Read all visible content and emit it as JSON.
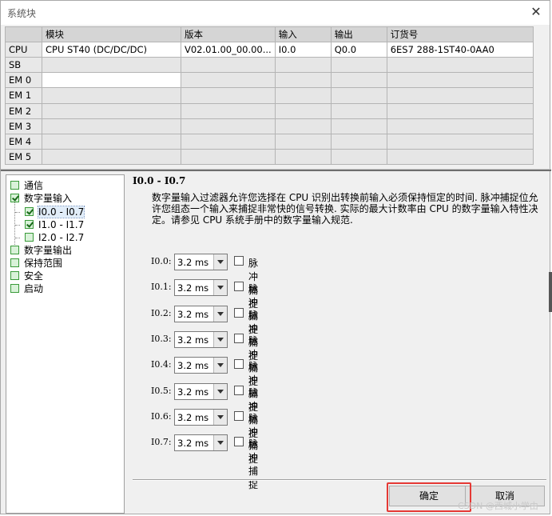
{
  "window": {
    "title": "系统块",
    "close_glyph": "✕"
  },
  "hardware_table": {
    "headers": [
      "",
      "模块",
      "版本",
      "输入",
      "输出",
      "订货号"
    ],
    "rows": [
      [
        "CPU",
        "CPU ST40 (DC/DC/DC)",
        "V02.01.00_00.00...",
        "I0.0",
        "Q0.0",
        "6ES7 288-1ST40-0AA0"
      ],
      [
        "SB",
        "",
        "",
        "",
        "",
        ""
      ],
      [
        "EM 0",
        "",
        "",
        "",
        "",
        ""
      ],
      [
        "EM 1",
        "",
        "",
        "",
        "",
        ""
      ],
      [
        "EM 2",
        "",
        "",
        "",
        "",
        ""
      ],
      [
        "EM 3",
        "",
        "",
        "",
        "",
        ""
      ],
      [
        "EM 4",
        "",
        "",
        "",
        "",
        ""
      ],
      [
        "EM 5",
        "",
        "",
        "",
        "",
        ""
      ]
    ]
  },
  "tree": {
    "items": [
      {
        "label": "通信",
        "checked": false
      },
      {
        "label": "数字量输入",
        "checked": true
      },
      {
        "label": "I0.0 - I0.7",
        "checked": true,
        "selected": true
      },
      {
        "label": "I1.0 - I1.7",
        "checked": true
      },
      {
        "label": "I2.0 - I2.7",
        "checked": false
      },
      {
        "label": "数字量输出",
        "checked": false
      },
      {
        "label": "保持范围",
        "checked": false
      },
      {
        "label": "安全",
        "checked": false
      },
      {
        "label": "启动",
        "checked": false
      }
    ]
  },
  "panel": {
    "title": "I0.0 - I0.7",
    "description": "数字量输入过滤器允许您选择在 CPU 识别出转换前输入必须保持恒定的时间. 脉冲捕捉位允许您组态一个输入来捕捉非常快的信号转换. 实际的最大计数率由 CPU 的数字量输入特性决定。请参见 CPU 系统手册中的数字量输入规范.",
    "pulse_label": "脉冲捕捉",
    "inputs": [
      {
        "label": "I0.0:",
        "filter": "3.2 ms",
        "pulse_catch": false
      },
      {
        "label": "I0.1:",
        "filter": "3.2 ms",
        "pulse_catch": false
      },
      {
        "label": "I0.2:",
        "filter": "3.2 ms",
        "pulse_catch": false
      },
      {
        "label": "I0.3:",
        "filter": "3.2 ms",
        "pulse_catch": false
      },
      {
        "label": "I0.4:",
        "filter": "3.2 ms",
        "pulse_catch": false
      },
      {
        "label": "I0.5:",
        "filter": "3.2 ms",
        "pulse_catch": false
      },
      {
        "label": "I0.6:",
        "filter": "3.2 ms",
        "pulse_catch": false
      },
      {
        "label": "I0.7:",
        "filter": "3.2 ms",
        "pulse_catch": false
      }
    ]
  },
  "buttons": {
    "ok": "确定",
    "cancel": "取消"
  },
  "watermark": "CSDN @西城小学由",
  "colors": {
    "highlight": "#e53935",
    "tree_check": "#3a9b3a"
  }
}
